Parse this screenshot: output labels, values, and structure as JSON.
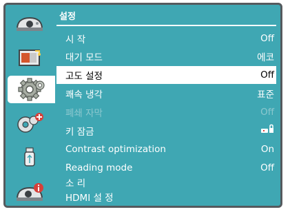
{
  "menu": {
    "title": "설정",
    "items": [
      {
        "label": "시 작",
        "value": "Off",
        "state": "normal"
      },
      {
        "label": "대기 모드",
        "value": "에코",
        "state": "normal"
      },
      {
        "label": "고도 설정",
        "value": "Off",
        "state": "selected"
      },
      {
        "label": "쾌속 냉각",
        "value": "표준",
        "state": "normal"
      },
      {
        "label": "폐쇄 자막",
        "value": "Off",
        "state": "disabled"
      },
      {
        "label": "키 잠금",
        "value": "",
        "value_icon": "remote-lock-icon",
        "state": "normal"
      },
      {
        "label": "Contrast optimization",
        "value": "On",
        "state": "normal"
      },
      {
        "label": "Reading mode",
        "value": "Off",
        "state": "normal"
      },
      {
        "label": "소 리",
        "value": "",
        "state": "normal"
      },
      {
        "label": "HDMI 설 정",
        "value": "",
        "state": "normal"
      }
    ]
  },
  "sidebar": {
    "icons": [
      {
        "name": "display-setup-icon",
        "selected": false
      },
      {
        "name": "image-adjust-icon",
        "selected": false
      },
      {
        "name": "settings-gears-icon",
        "selected": true
      },
      {
        "name": "advanced-settings-icon",
        "selected": false
      },
      {
        "name": "usb-icon",
        "selected": false
      },
      {
        "name": "information-icon",
        "selected": false
      }
    ]
  },
  "colors": {
    "background": "#3fa7b3",
    "highlight": "#ffffff",
    "text": "#ffffff",
    "disabled_text": "#8cc8cf",
    "frame": "#555a5e"
  }
}
